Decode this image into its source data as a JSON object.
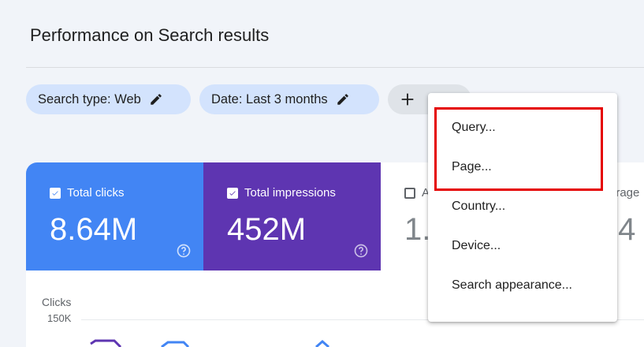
{
  "page": {
    "title": "Performance on Search results"
  },
  "filters": {
    "search_type": "Search type: Web",
    "date": "Date: Last 3 months",
    "add_icon": "plus-icon",
    "edit_icon": "pencil-icon"
  },
  "metrics": {
    "clicks": {
      "label": "Total clicks",
      "value": "8.64M",
      "checked": true,
      "color": "#4285f4"
    },
    "impressions": {
      "label": "Total impressions",
      "value": "452M",
      "checked": true,
      "color": "#5e35b1"
    },
    "ctr": {
      "label": "A",
      "value": "1.",
      "checked": false
    },
    "position": {
      "label": "erage",
      "value": ".4"
    }
  },
  "chart": {
    "ylabel": "Clicks",
    "top_tick": "150K"
  },
  "menu": {
    "items": [
      "Query...",
      "Page...",
      "Country...",
      "Device...",
      "Search appearance..."
    ]
  },
  "colors": {
    "highlight": "#e50000",
    "chip_bg": "#d3e3fd"
  }
}
